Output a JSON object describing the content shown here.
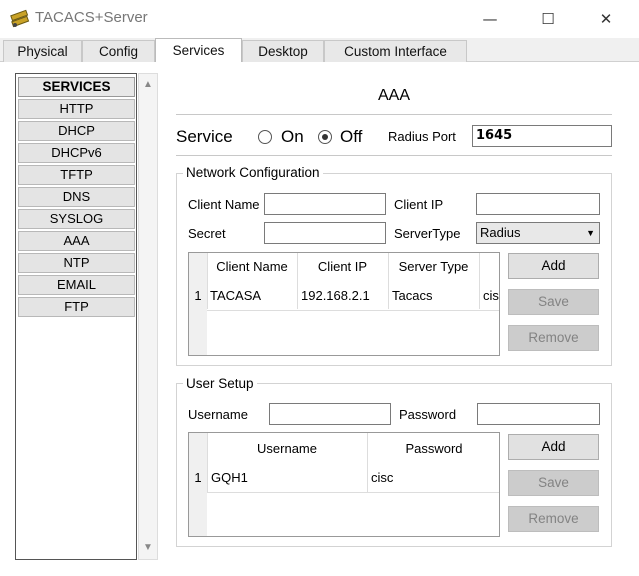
{
  "window": {
    "title": "TACACS+Server",
    "controls": {
      "minimize": "—",
      "maximize": "☐",
      "close": "✕"
    }
  },
  "tabs": [
    {
      "label": "Physical"
    },
    {
      "label": "Config"
    },
    {
      "label": "Services",
      "active": true
    },
    {
      "label": "Desktop"
    },
    {
      "label": "Custom Interface"
    }
  ],
  "services": {
    "header": "SERVICES",
    "items": [
      "HTTP",
      "DHCP",
      "DHCPv6",
      "TFTP",
      "DNS",
      "SYSLOG",
      "AAA",
      "NTP",
      "EMAIL",
      "FTP"
    ]
  },
  "aaa": {
    "title": "AAA",
    "service_label": "Service",
    "on_label": "On",
    "off_label": "Off",
    "selected": "Off",
    "radius_port_label": "Radius Port",
    "radius_port_value": "1645"
  },
  "network": {
    "title": "Network Configuration",
    "client_name_label": "Client Name",
    "client_name_value": "",
    "client_ip_label": "Client IP",
    "client_ip_value": "",
    "secret_label": "Secret",
    "secret_value": "",
    "server_type_label": "ServerType",
    "server_type_value": "Radius",
    "columns": [
      "Client Name",
      "Client IP",
      "Server Type"
    ],
    "rows": [
      {
        "index": "1",
        "client_name": "TACASA",
        "client_ip": "192.168.2.1",
        "server_type": "Tacacs",
        "key": "cis"
      }
    ],
    "buttons": {
      "add": "Add",
      "save": "Save",
      "remove": "Remove"
    }
  },
  "user": {
    "title": "User Setup",
    "username_label": "Username",
    "username_value": "",
    "password_label": "Password",
    "password_value": "",
    "columns": [
      "Username",
      "Password"
    ],
    "rows": [
      {
        "index": "1",
        "username": "GQH1",
        "password": "cisc"
      }
    ],
    "buttons": {
      "add": "Add",
      "save": "Save",
      "remove": "Remove"
    }
  },
  "colors": {
    "disabled_button": "#cccccc",
    "disabled_text": "#838383",
    "tab_bg": "#e8e8e8"
  }
}
